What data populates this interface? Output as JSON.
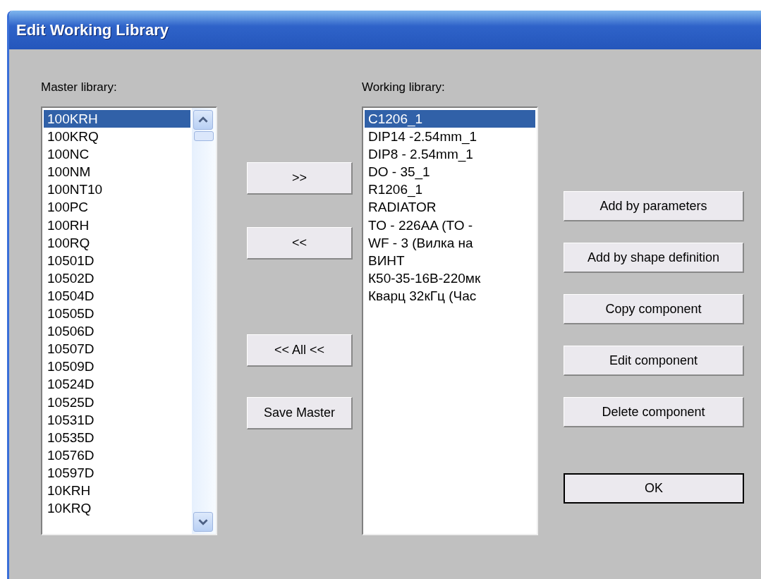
{
  "window": {
    "title": "Edit Working Library"
  },
  "master_library": {
    "label": "Master library:",
    "items": [
      {
        "text": "100KRH",
        "selected": true
      },
      {
        "text": "100KRQ",
        "selected": false
      },
      {
        "text": "100NC",
        "selected": false
      },
      {
        "text": "100NM",
        "selected": false
      },
      {
        "text": "100NT10",
        "selected": false
      },
      {
        "text": "100PC",
        "selected": false
      },
      {
        "text": "100RH",
        "selected": false
      },
      {
        "text": "100RQ",
        "selected": false
      },
      {
        "text": "10501D",
        "selected": false
      },
      {
        "text": "10502D",
        "selected": false
      },
      {
        "text": "10504D",
        "selected": false
      },
      {
        "text": "10505D",
        "selected": false
      },
      {
        "text": "10506D",
        "selected": false
      },
      {
        "text": "10507D",
        "selected": false
      },
      {
        "text": "10509D",
        "selected": false
      },
      {
        "text": "10524D",
        "selected": false
      },
      {
        "text": "10525D",
        "selected": false
      },
      {
        "text": "10531D",
        "selected": false
      },
      {
        "text": "10535D",
        "selected": false
      },
      {
        "text": "10576D",
        "selected": false
      },
      {
        "text": "10597D",
        "selected": false
      },
      {
        "text": "10KRH",
        "selected": false
      },
      {
        "text": "10KRQ",
        "selected": false
      }
    ]
  },
  "transfer_buttons": [
    ">>",
    "<<",
    "<< All <<",
    "Save Master"
  ],
  "working_library": {
    "label": "Working library:",
    "items": [
      {
        "text": "C1206_1",
        "selected": true
      },
      {
        "text": "DIP14 -2.54mm_1",
        "selected": false
      },
      {
        "text": "DIP8 - 2.54mm_1",
        "selected": false
      },
      {
        "text": "DO - 35_1",
        "selected": false
      },
      {
        "text": "R1206_1",
        "selected": false
      },
      {
        "text": "RADIATOR",
        "selected": false
      },
      {
        "text": "TO - 226AA (TO -",
        "selected": false
      },
      {
        "text": "WF - 3 (Вилка на",
        "selected": false
      },
      {
        "text": "ВИНТ",
        "selected": false
      },
      {
        "text": "К50-35-16В-220мк",
        "selected": false
      },
      {
        "text": "Кварц 32кГц (Час",
        "selected": false
      }
    ]
  },
  "action_buttons": [
    {
      "label": "Add by parameters",
      "default": false
    },
    {
      "label": "Add by shape definition",
      "default": false
    },
    {
      "label": "Copy component",
      "default": false
    },
    {
      "label": "Edit component",
      "default": false
    },
    {
      "label": "Delete component",
      "default": false
    },
    {
      "label": "OK",
      "default": true
    }
  ]
}
